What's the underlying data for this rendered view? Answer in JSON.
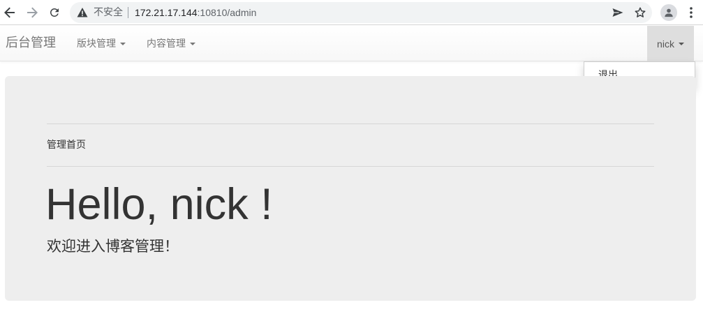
{
  "browser": {
    "security_label": "不安全",
    "url_host": "172.21.17.144",
    "url_rest": ":10810/admin"
  },
  "navbar": {
    "brand": "后台管理",
    "menus": [
      {
        "label": "版块管理"
      },
      {
        "label": "内容管理"
      }
    ],
    "user": "nick"
  },
  "dropdown": {
    "items": [
      {
        "label": "退出"
      }
    ]
  },
  "main": {
    "breadcrumb": "管理首页",
    "heading": "Hello, nick !",
    "subheading": "欢迎进入博客管理！"
  },
  "icons": {
    "back": "arrow-left-icon",
    "forward": "arrow-right-icon",
    "reload": "reload-icon",
    "warning": "warning-triangle-icon",
    "send": "send-icon",
    "bookmark": "star-icon",
    "profile": "person-icon",
    "menu": "kebab-menu-icon"
  },
  "colors": {
    "jumbotron_bg": "#eeeeee",
    "navbar_text": "#777777",
    "body_text": "#333333",
    "active_user_bg": "#dedede"
  }
}
